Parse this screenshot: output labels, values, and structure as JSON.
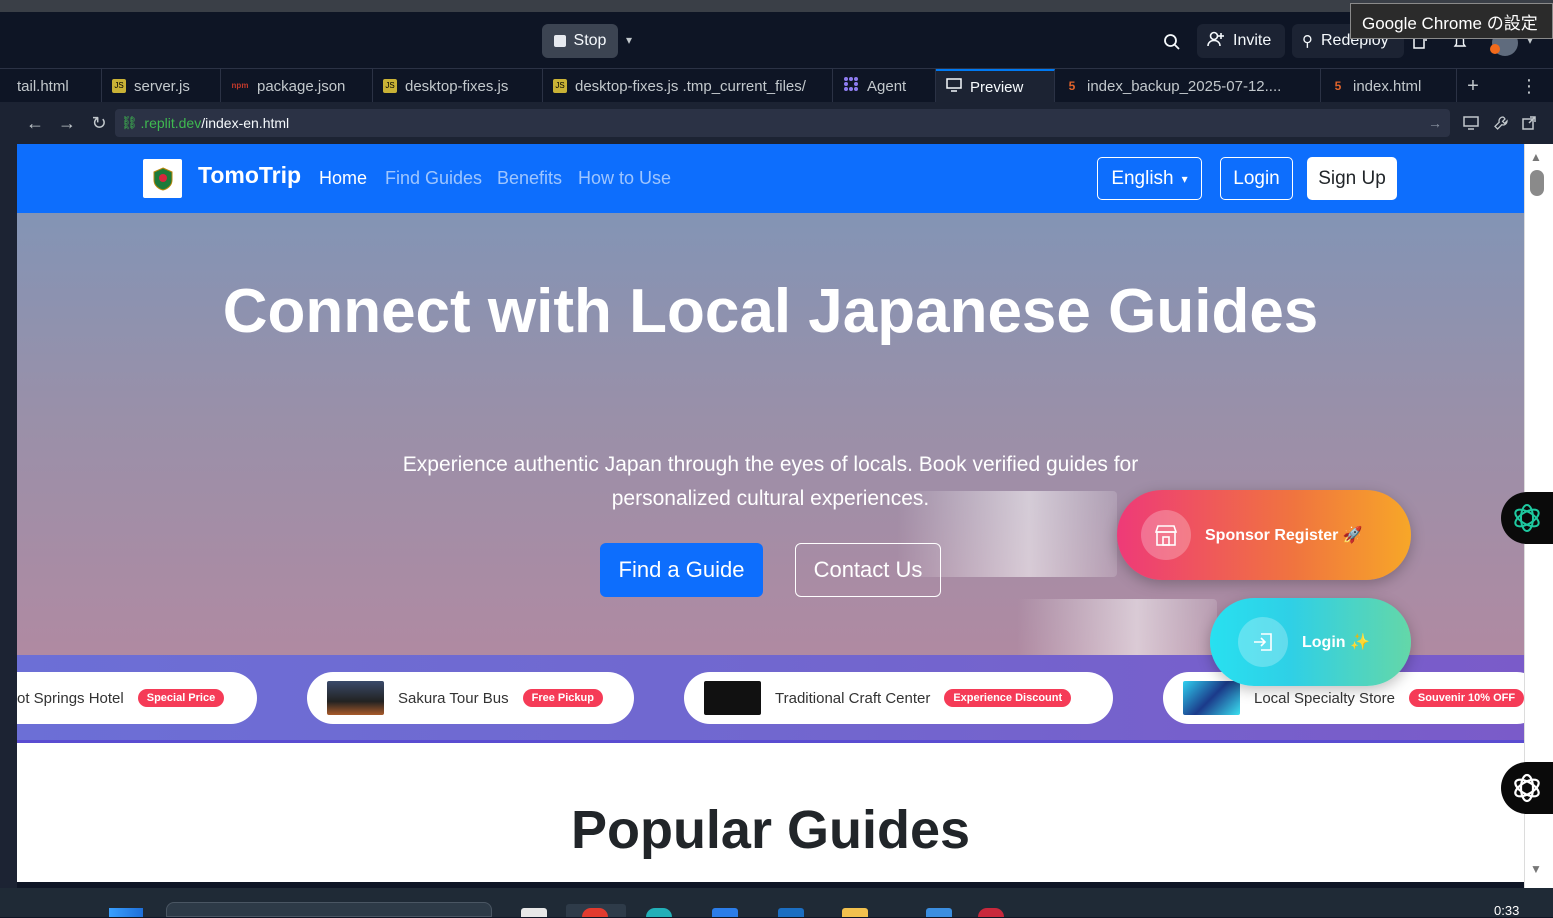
{
  "top": {
    "stop_label": "Stop",
    "invite_label": "Invite",
    "redeploy_label": "Redeploy",
    "tooltip": "Google Chrome の設定"
  },
  "tabs": [
    {
      "label": "tail.html",
      "icon": "html-file-icon"
    },
    {
      "label": "server.js",
      "icon": "js-file-icon"
    },
    {
      "label": "package.json",
      "icon": "npm-file-icon"
    },
    {
      "label": "desktop-fixes.js",
      "icon": "js-file-icon"
    },
    {
      "label": "desktop-fixes.js .tmp_current_files/",
      "icon": "js-file-icon"
    },
    {
      "label": "Agent",
      "icon": "agent-icon"
    },
    {
      "label": "Preview",
      "icon": "monitor-icon"
    },
    {
      "label": "index_backup_2025-07-12....",
      "icon": "html-file-icon"
    },
    {
      "label": "index.html",
      "icon": "html-file-icon"
    }
  ],
  "browser": {
    "url_domain": ".replit.dev",
    "url_path": "/index-en.html"
  },
  "site": {
    "brand": "TomoTrip",
    "nav": [
      "Home",
      "Find Guides",
      "Benefits",
      "How to Use"
    ],
    "language": "English",
    "login": "Login",
    "signup": "Sign Up"
  },
  "hero": {
    "title": "Connect with Local Japanese Guides",
    "subtitle": "Experience authentic Japan through the eyes of locals. Book verified guides for personalized cultural experiences.",
    "find_guide": "Find a Guide",
    "contact_us": "Contact Us"
  },
  "sponsors": [
    {
      "name": "ot Springs Hotel",
      "badge": "Special Price"
    },
    {
      "name": "Sakura Tour Bus",
      "badge": "Free Pickup"
    },
    {
      "name": "Traditional Craft Center",
      "badge": "Experience Discount"
    },
    {
      "name": "Local Specialty Store",
      "badge": "Souvenir 10% OFF"
    }
  ],
  "floating": {
    "sponsor_register": "Sponsor Register 🚀",
    "login": "Login ✨"
  },
  "section": {
    "popular_guides": "Popular Guides"
  },
  "taskbar": {
    "clock": "0:33"
  },
  "colors": {
    "navbar": "#0d6efd",
    "accent_red": "#f53b57",
    "ide_bg": "#0e1525"
  }
}
